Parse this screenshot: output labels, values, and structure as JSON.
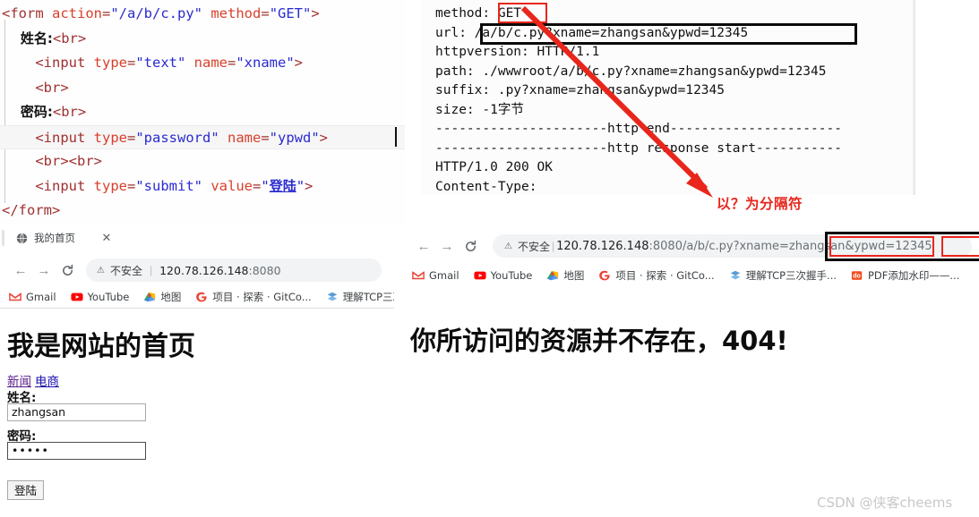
{
  "editor": {
    "lines": [
      [
        {
          "t": "tag",
          "s": "<form "
        },
        {
          "t": "attr",
          "s": "action"
        },
        {
          "t": "tag",
          "s": "="
        },
        {
          "t": "str",
          "s": "\"/a/b/c.py\""
        },
        {
          "t": "tag",
          "s": " "
        },
        {
          "t": "attr",
          "s": "method"
        },
        {
          "t": "tag",
          "s": "="
        },
        {
          "t": "str",
          "s": "\"GET\""
        },
        {
          "t": "tag",
          "s": ">"
        }
      ],
      [
        {
          "t": "cn",
          "s": "    姓名:"
        },
        {
          "t": "tag",
          "s": "<br>"
        }
      ],
      [
        {
          "t": "tag",
          "s": "    <input "
        },
        {
          "t": "attr",
          "s": "type"
        },
        {
          "t": "tag",
          "s": "="
        },
        {
          "t": "str",
          "s": "\"text\""
        },
        {
          "t": "tag",
          "s": " "
        },
        {
          "t": "attr",
          "s": "name"
        },
        {
          "t": "tag",
          "s": "="
        },
        {
          "t": "str",
          "s": "\"xname\""
        },
        {
          "t": "tag",
          "s": ">"
        }
      ],
      [
        {
          "t": "tag",
          "s": "    <br>"
        }
      ],
      [
        {
          "t": "cn",
          "s": "    密码:"
        },
        {
          "t": "tag",
          "s": "<br>"
        }
      ],
      [
        {
          "t": "tag",
          "s": "    <input "
        },
        {
          "t": "attr",
          "s": "type"
        },
        {
          "t": "tag",
          "s": "="
        },
        {
          "t": "str",
          "s": "\"password\""
        },
        {
          "t": "tag",
          "s": " "
        },
        {
          "t": "attr",
          "s": "name"
        },
        {
          "t": "tag",
          "s": "="
        },
        {
          "t": "str",
          "s": "\"ypwd\""
        },
        {
          "t": "tag",
          "s": ">"
        }
      ],
      [
        {
          "t": "tag",
          "s": "    <br><br>"
        }
      ],
      [
        {
          "t": "tag",
          "s": "    <input "
        },
        {
          "t": "attr",
          "s": "type"
        },
        {
          "t": "tag",
          "s": "="
        },
        {
          "t": "str",
          "s": "\"submit\""
        },
        {
          "t": "tag",
          "s": " "
        },
        {
          "t": "attr",
          "s": "value"
        },
        {
          "t": "tag",
          "s": "="
        },
        {
          "t": "str",
          "s": "\""
        },
        {
          "t": "strcn",
          "s": "登陆"
        },
        {
          "t": "str",
          "s": "\""
        },
        {
          "t": "tag",
          "s": ">"
        }
      ],
      [
        {
          "t": "tag",
          "s": "</form>"
        }
      ]
    ],
    "highlighted_line_index": 5
  },
  "console": {
    "lines": [
      "method: GET",
      "url: /a/b/c.py?xname=zhangsan&ypwd=12345",
      "httpversion: HTTP/1.1",
      "path: ./wwwroot/a/b/c.py?xname=zhangsan&ypwd=12345",
      "suffix: .py?xname=zhangsan&ypwd=12345",
      "size: -1字节",
      "----------------------http end----------------------",
      "----------------------http response start-----------",
      "HTTP/1.0 200 OK",
      "Content-Type:"
    ]
  },
  "annotation": {
    "text": "以？为分隔符",
    "color": "#e8261b"
  },
  "browser_left": {
    "tab": {
      "title": "我的首页",
      "close_label": "✕"
    },
    "nav": {
      "back": "←",
      "forward": "→",
      "reload": "⟳"
    },
    "omnibox": {
      "security_label": "不安全",
      "separator": "|",
      "url_host": "120.78.126.148",
      "url_port": ":8080"
    },
    "bookmarks": [
      {
        "label": "Gmail",
        "icon": "gmail-icon"
      },
      {
        "label": "YouTube",
        "icon": "youtube-icon"
      },
      {
        "label": "地图",
        "icon": "maps-icon"
      },
      {
        "label": "项目 · 探索 · GitCo...",
        "icon": "google-icon"
      },
      {
        "label": "理解TCP三次握手...",
        "icon": "csdn-icon"
      }
    ],
    "page": {
      "heading": "我是网站的首页",
      "link_news": "新闻",
      "link_shop": "电商",
      "label_name": "姓名:",
      "value_name": "zhangsan",
      "label_pwd": "密码:",
      "value_pwd": "•••••",
      "submit_label": "登陆"
    }
  },
  "browser_right": {
    "nav": {
      "back": "←",
      "forward": "→",
      "reload": "C"
    },
    "omnibox": {
      "security_label": "不安全",
      "separator": "|",
      "url_host": "120.78.126.148",
      "url_port": ":8080",
      "url_path": "/a/b/c.py",
      "url_qmark": "?",
      "url_param1": "xname=zhangsan",
      "url_amp": "&",
      "url_param2": "ypwd=12345"
    },
    "bookmarks": [
      {
        "label": "Gmail",
        "icon": "gmail-icon"
      },
      {
        "label": "YouTube",
        "icon": "youtube-icon"
      },
      {
        "label": "地图",
        "icon": "maps-icon"
      },
      {
        "label": "项目 · 探索 · GitCo...",
        "icon": "google-icon"
      },
      {
        "label": "理解TCP三次握手...",
        "icon": "csdn-icon"
      },
      {
        "label": "PDF添加水印——...",
        "icon": "docs-icon"
      }
    ],
    "page": {
      "heading": "你所访问的资源并不存在，404!"
    }
  },
  "watermark": {
    "text": "CSDN @侠客cheems"
  }
}
